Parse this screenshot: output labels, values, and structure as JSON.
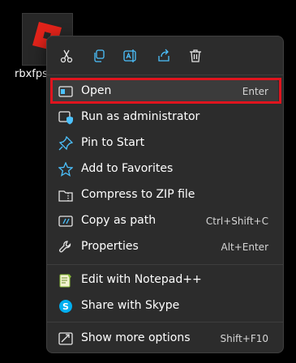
{
  "desktop": {
    "file_label": "rbxfpsu"
  },
  "quick_actions": [
    {
      "name": "cut-icon"
    },
    {
      "name": "copy-icon"
    },
    {
      "name": "rename-icon"
    },
    {
      "name": "share-icon"
    },
    {
      "name": "delete-icon"
    }
  ],
  "menu": {
    "items": [
      {
        "label": "Open",
        "shortcut": "Enter",
        "icon": "open-app-icon"
      },
      {
        "label": "Run as administrator",
        "shortcut": "",
        "icon": "shield-window-icon"
      },
      {
        "label": "Pin to Start",
        "shortcut": "",
        "icon": "pin-icon"
      },
      {
        "label": "Add to Favorites",
        "shortcut": "",
        "icon": "star-icon"
      },
      {
        "label": "Compress to ZIP file",
        "shortcut": "",
        "icon": "zip-folder-icon"
      },
      {
        "label": "Copy as path",
        "shortcut": "Ctrl+Shift+C",
        "icon": "copy-path-icon"
      },
      {
        "label": "Properties",
        "shortcut": "Alt+Enter",
        "icon": "wrench-icon"
      },
      {
        "label": "Edit with Notepad++",
        "shortcut": "",
        "icon": "notepad-plus-plus-icon"
      },
      {
        "label": "Share with Skype",
        "shortcut": "",
        "icon": "skype-icon"
      },
      {
        "label": "Show more options",
        "shortcut": "Shift+F10",
        "icon": "more-options-icon"
      }
    ]
  },
  "colors": {
    "accent": "#4cc2ff",
    "highlight_frame": "#e0141e",
    "menu_bg": "#2c2c2c"
  }
}
